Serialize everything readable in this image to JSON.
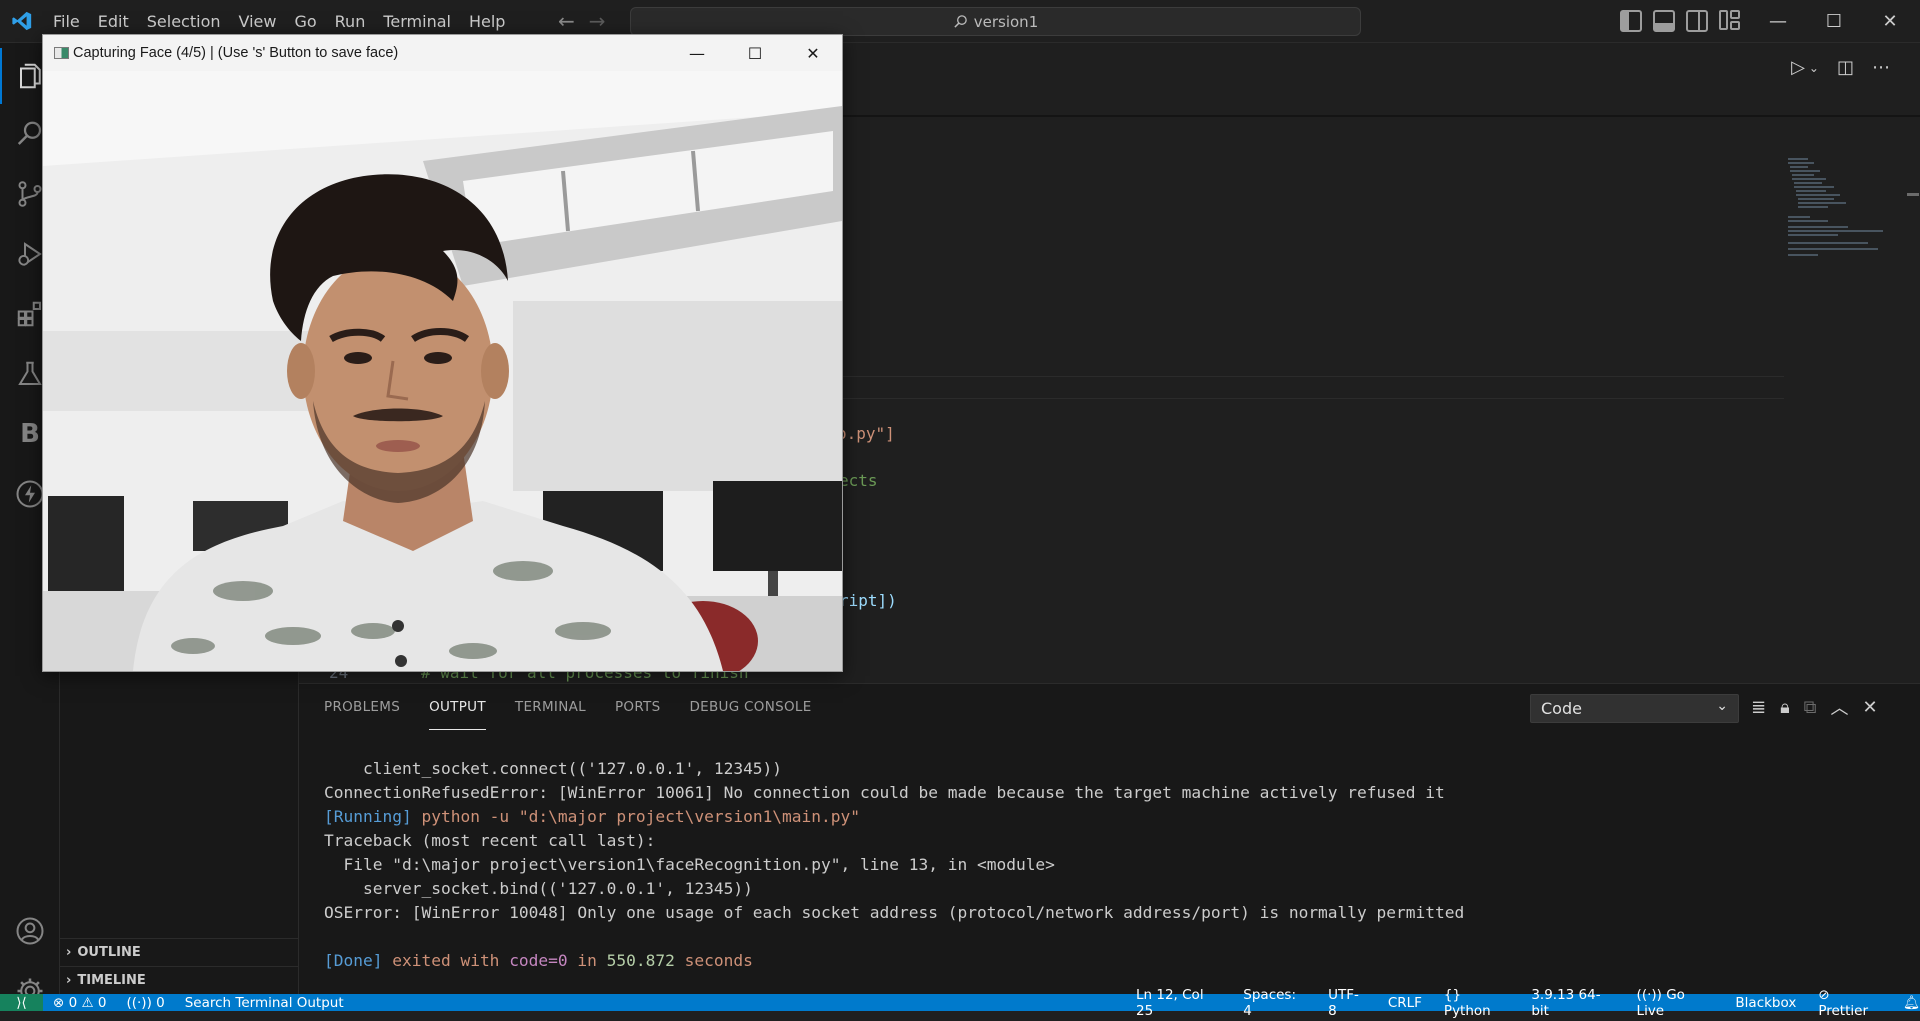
{
  "menu": [
    "File",
    "Edit",
    "Selection",
    "View",
    "Go",
    "Run",
    "Terminal",
    "Help"
  ],
  "search": {
    "label": "version1"
  },
  "editor": {
    "fragments": [
      {
        "text": "o.py\"]",
        "color": "#ce9178"
      },
      {
        "text": "ects",
        "color": "#6a9955"
      },
      {
        "text": "ript])",
        "color": "#9cdcfe"
      },
      {
        "text": "# wait for all processes to finish",
        "color": "#6a9955"
      }
    ],
    "line_number": "24"
  },
  "camera_window": {
    "title": "Capturing Face (4/5) | (Use 's' Button to save face)"
  },
  "sidebar": {
    "sections": [
      "OUTLINE",
      "TIMELINE"
    ]
  },
  "panel": {
    "tabs": [
      "PROBLEMS",
      "OUTPUT",
      "TERMINAL",
      "PORTS",
      "DEBUG CONSOLE"
    ],
    "active_tab": "OUTPUT",
    "channel": "Code",
    "output": {
      "line1": "    client_socket.connect(('127.0.0.1', 12345))",
      "line2": "ConnectionRefusedError: [WinError 10061] No connection could be made because the target machine actively refused it",
      "line3_tag": "[Running]",
      "line3_cmd": " python -u \"d:\\major project\\version1\\main.py\"",
      "line4": "Traceback (most recent call last):",
      "line5": "  File \"d:\\major project\\version1\\faceRecognition.py\", line 13, in <module>",
      "line6": "    server_socket.bind(('127.0.0.1', 12345))",
      "line7": "OSError: [WinError 10048] Only one usage of each socket address (protocol/network address/port) is normally permitted",
      "done_tag": "[Done]",
      "done_a": " exited with ",
      "done_code": "code=0",
      "done_b": " in ",
      "done_time": "550.872",
      "done_c": " seconds"
    }
  },
  "statusbar": {
    "errors": "0",
    "warnings": "0",
    "ports": "0",
    "search_terminal": "Search Terminal Output",
    "position": "Ln 12, Col 25",
    "spaces": "Spaces: 4",
    "encoding": "UTF-8",
    "eol": "CRLF",
    "language": "Python",
    "interpreter": "3.9.13 64-bit",
    "golive": "Go Live",
    "blackbox": "Blackbox",
    "prettier": "Prettier"
  },
  "colors": {
    "accent": "#0078d4",
    "statusbar": "#007acc",
    "remote": "#16825d"
  }
}
